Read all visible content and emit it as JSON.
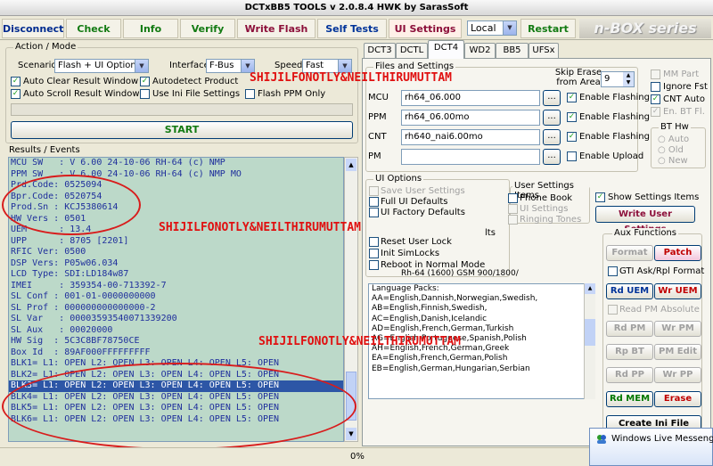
{
  "window": {
    "title": "DCTxBB5 TOOLS v 2.0.8.4 HWK by SarasSoft"
  },
  "toolbar": {
    "disconnect": "Disconnect",
    "check": "Check",
    "info": "Info",
    "verify": "Verify",
    "write_flash": "Write Flash",
    "self_tests": "Self Tests",
    "ui_settings": "UI Settings",
    "connection": "Local",
    "restart": "Restart",
    "brand": "n-BOX series"
  },
  "action_mode": {
    "legend": "Action / Mode",
    "scenario_label": "Scenario",
    "scenario_value": "Flash + UI Options",
    "interface_label": "Interface",
    "interface_value": "F-Bus",
    "speed_label": "Speed",
    "speed_value": "Fast",
    "auto_clear": "Auto Clear Result Window",
    "autodetect": "Autodetect Product",
    "flash_ppm": "Flash PPM Only",
    "auto_scroll": "Auto Scroll Result Window",
    "use_ini": "Use Ini File Settings",
    "start": "START"
  },
  "results": {
    "legend": "Results / Events",
    "lines": [
      "MCU SW   : V 6.00 24-10-06 RH-64 (c) NMP",
      "PPM SW   : V 6.00 24-10-06 RH-64 (c) NMP MO",
      "Prd.Code: 0525094",
      "Bpr.Code: 0520754",
      "Prod.Sn : KCJ5380614",
      "HW Vers : 0501",
      "UEM      : 13.4",
      "UPP      : 8705 [2201]",
      "RFIC Ver: 0500",
      "DSP Vers: P05w06.034",
      "LCD Type: SDI:LD184w87",
      "IMEI     : 359354-00-713392-7",
      "SL Conf : 001-01-0000000000",
      "SL Prof : 000000000000000-2",
      "SL Var   : 00003593540071339200",
      "SL Aux   : 00020000",
      "HW Sig  : 5C3C8BF78750CE",
      "Box Id  : 89AF000FFFFFFFFF",
      "BLK1= L1: OPEN L2: OPEN L3: OPEN L4: OPEN L5: OPEN",
      "BLK2= L1: OPEN L2: OPEN L3: OPEN L4: OPEN L5: OPEN",
      "BLK3= L1: OPEN L2: OPEN L3: OPEN L4: OPEN L5: OPEN",
      "BLK4= L1: OPEN L2: OPEN L3: OPEN L4: OPEN L5: OPEN",
      "BLK5= L1: OPEN L2: OPEN L3: OPEN L4: OPEN L5: OPEN",
      "BLK6= L1: OPEN L2: OPEN L3: OPEN L4: OPEN L5: OPEN"
    ],
    "highlight_index": 20
  },
  "watermark": {
    "text": "SHIJILFONOTLY&NEILTHIRUMUTTAM"
  },
  "tabs": [
    "DCT3",
    "DCTL",
    "DCT4",
    "WD2",
    "BB5",
    "UFSx"
  ],
  "files": {
    "legend": "Files and Settings",
    "skip_erase": "Skip Erase from Area",
    "skip_value": "9",
    "rows": [
      {
        "label": "MCU",
        "value": "rh64_06.000",
        "check": "Enable Flashing"
      },
      {
        "label": "PPM",
        "value": "rh64_06.00mo",
        "check": "Enable Flashing"
      },
      {
        "label": "CNT",
        "value": "rh640_nai6.00mo",
        "check": "Enable Flashing"
      },
      {
        "label": "PM",
        "value": "",
        "check": "Enable Upload"
      }
    ],
    "browse": "...",
    "mm_part": "MM Part",
    "ignore_fst": "Ignore Fst",
    "cnt_auto": "CNT Auto",
    "en_bt": "En. BT Fl.",
    "bt_hw": "BT Hw",
    "bt_auto": "Auto",
    "bt_old": "Old",
    "bt_new": "New"
  },
  "ui_options": {
    "legend": "UI Options",
    "save": "Save User Settings",
    "full": "Full UI Defaults",
    "factory": "UI Factory Defaults",
    "reset_user_lock": "Reset User Lock",
    "init_simlocks": "Init SimLocks",
    "reboot": "Reboot in Normal Mode",
    "hidden_suffix": "lts"
  },
  "user_settings": {
    "legend": "User Settings Items",
    "phone_book": "Phone Book",
    "ui_settings": "UI Settings",
    "ringing": "Ringing Tones",
    "show": "Show Settings Items",
    "write": "Write User Settings"
  },
  "language": {
    "header": "Rh-64 (1600) GSM 900/1800/",
    "title": "Language Packs:",
    "lines": [
      "AA=English,Dannish,Norwegian,Swedish,",
      "AB=English,Finnish,Swedish,",
      "AC=English,Danish,Icelandic",
      "AD=English,French,German,Turkish",
      "AG=English,Portuguese,Spanish,Polish",
      "AH=English,French,German,Greek",
      "EA=English,French,German,Polish",
      "EB=English,German,Hungarian,Serbian"
    ]
  },
  "aux": {
    "legend": "Aux Functions",
    "format": "Format",
    "patch": "Patch",
    "gti": "GTI Ask/Rpl Format",
    "rd_uem": "Rd UEM",
    "wr_uem": "Wr UEM",
    "read_pm": "Read PM Absolute",
    "rd_pm": "Rd PM",
    "wr_pm": "Wr PM",
    "rp_bt": "Rp BT",
    "pm_edit": "PM Edit",
    "rd_pp": "Rd PP",
    "wr_pp": "Wr PP",
    "rd_mem": "Rd MEM",
    "erase": "Erase",
    "create_ini": "Create Ini File"
  },
  "status": {
    "progress": "0%"
  },
  "messenger": {
    "title": "Windows Live Messenger"
  },
  "colors": {
    "accent_red": "#d81c1c",
    "results_bg": "#bcd9c9",
    "results_text": "#1f2f9c"
  }
}
